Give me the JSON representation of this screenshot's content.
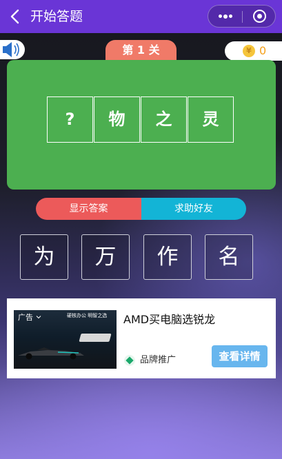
{
  "header": {
    "title": "开始答题",
    "back_icon": "chevron-left-icon"
  },
  "level": {
    "label": "第 1 关"
  },
  "coins": {
    "icon_symbol": "¥",
    "count": "0"
  },
  "puzzle": {
    "cells": [
      "?",
      "物",
      "之",
      "灵"
    ]
  },
  "actions": {
    "show_answer": "显示答案",
    "ask_friend": "求助好友"
  },
  "options": [
    "为",
    "万",
    "作",
    "名"
  ],
  "ad": {
    "tag": "广告",
    "image_caption": "硬核办公 明智之选",
    "headline": "AMD买电脑选锐龙",
    "brand_label": "品牌推广",
    "cta": "查看详情"
  },
  "colors": {
    "header": "#6a35d6",
    "board": "#4caf50",
    "level_tab": "#f07a68",
    "show_answer": "#ec5a5a",
    "ask_friend": "#13b4d6",
    "cta": "#68b6ee"
  }
}
